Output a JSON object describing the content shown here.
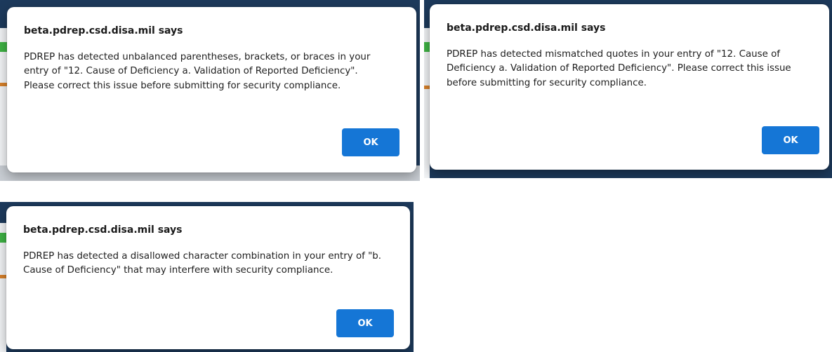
{
  "dialogs": [
    {
      "title": "beta.pdrep.csd.disa.mil says",
      "message": "PDREP has detected unbalanced parentheses, brackets, or braces in your entry of \"12. Cause of Deficiency a. Validation of Reported Deficiency\". Please correct this issue before submitting for security compliance.",
      "ok_label": "OK"
    },
    {
      "title": "beta.pdrep.csd.disa.mil says",
      "message": "PDREP has detected mismatched quotes in your entry of \"12. Cause of Deficiency a. Validation of Reported Deficiency\". Please correct this issue before submitting for security compliance.",
      "ok_label": "OK"
    },
    {
      "title": "beta.pdrep.csd.disa.mil says",
      "message": "PDREP has detected a disallowed character combination in your entry of \"b. Cause of Deficiency\" that may interfere with security compliance.",
      "ok_label": "OK"
    }
  ],
  "colors": {
    "ok_button": "#1576d6",
    "page_header": "#1d3a5c",
    "page_green": "#3fb545"
  }
}
